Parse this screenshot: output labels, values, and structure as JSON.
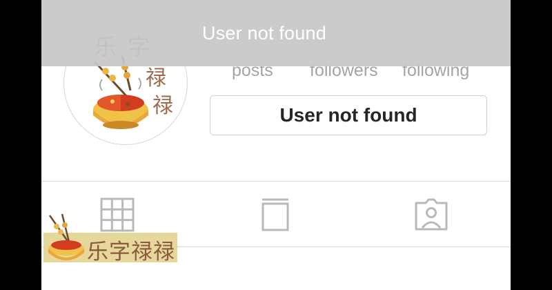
{
  "banner": {
    "message": "User not found"
  },
  "stats": {
    "posts_label": "posts",
    "followers_label": "followers",
    "following_label": "following"
  },
  "profile_button": {
    "label": "User not found"
  },
  "avatar": {
    "logo_text": "乐字禄禄"
  },
  "tabs": [
    {
      "icon": "grid-icon"
    },
    {
      "icon": "feed-icon"
    },
    {
      "icon": "tagged-person-icon"
    }
  ],
  "watermark": {
    "text": "乐字禄禄"
  },
  "colors": {
    "banner_bg": "#c7c7c7",
    "button_text": "#262626",
    "stat_text": "#a4a4a4",
    "watermark_bg": "#e6d89b",
    "watermark_text": "#8b5a3c"
  }
}
